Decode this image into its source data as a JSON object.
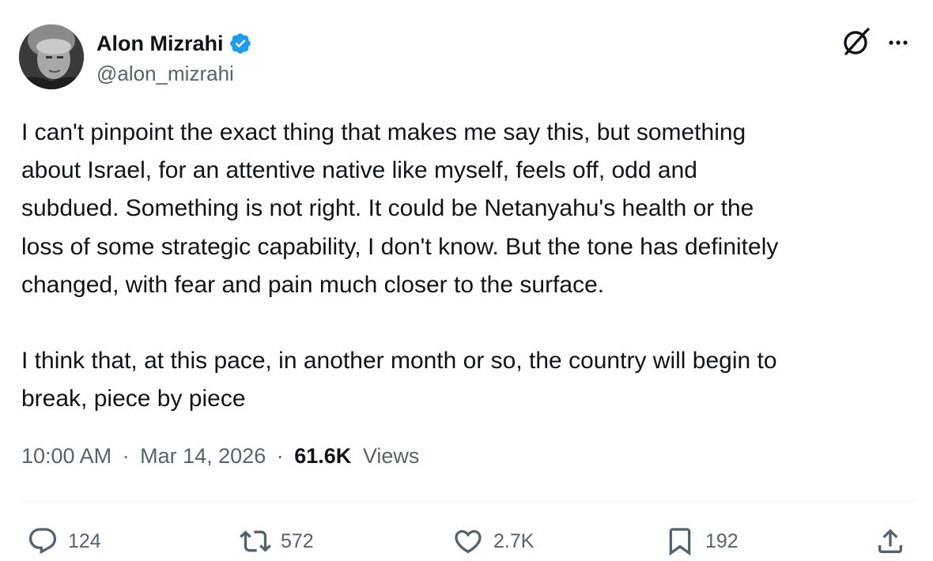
{
  "author": {
    "display_name": "Alon Mizrahi",
    "handle": "@alon_mizrahi",
    "verified_icon": "verified-badge-icon",
    "verified_color": "#1d9bf0"
  },
  "header_actions": {
    "grok_icon": "grok-icon",
    "more_icon": "more-horizontal-icon"
  },
  "tweet": {
    "paragraph1_lines": [
      "I can't pinpoint the exact thing that makes me say this, but something",
      "about Israel, for an attentive native like myself, feels off, odd and",
      "subdued. Something is not right. It could be Netanyahu's health or the",
      "loss of some strategic capability, I don't know. But the tone has definitely",
      "changed, with fear and pain much closer to the surface."
    ],
    "paragraph2_lines": [
      "I think that, at this pace, in another month or so, the country will begin to",
      "break, piece by piece"
    ]
  },
  "meta": {
    "time": "10:00 AM",
    "separator": "·",
    "date": "Mar 14, 2026",
    "views_count": "61.6K",
    "views_label": "Views"
  },
  "actions": {
    "reply": {
      "icon": "reply-icon",
      "count": "124"
    },
    "retweet": {
      "icon": "retweet-icon",
      "count": "572"
    },
    "like": {
      "icon": "heart-icon",
      "count": "2.7K"
    },
    "bookmark": {
      "icon": "bookmark-icon",
      "count": "192"
    },
    "share": {
      "icon": "share-icon"
    }
  },
  "colors": {
    "text_primary": "#0f1419",
    "text_secondary": "#536471",
    "divider": "#eff3f4"
  }
}
